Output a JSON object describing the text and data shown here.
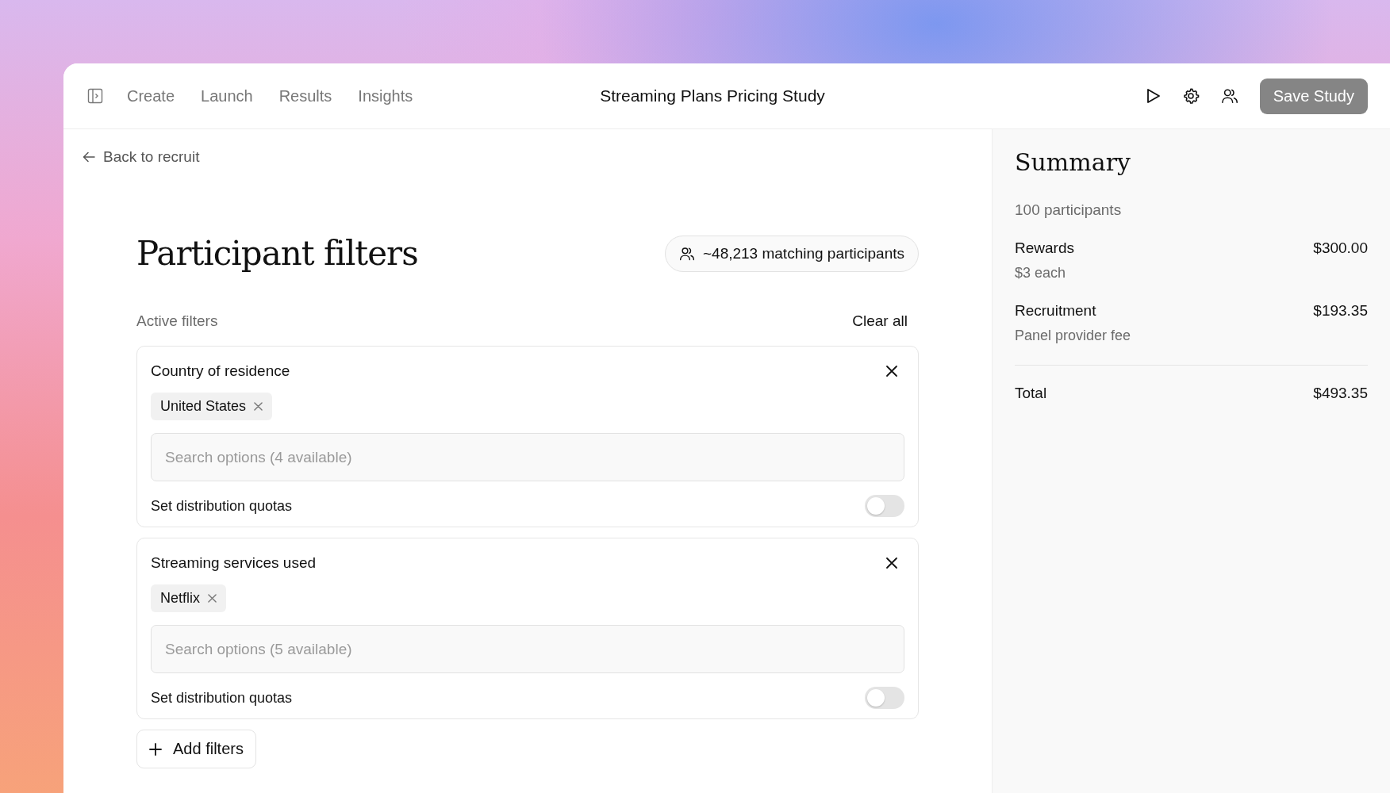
{
  "nav": {
    "tabs": [
      {
        "label": "Create",
        "selected": false
      },
      {
        "label": "Launch",
        "selected": false
      },
      {
        "label": "Results",
        "selected": false
      },
      {
        "label": "Insights",
        "selected": false
      }
    ]
  },
  "title": "Streaming Plans Pricing Study",
  "save_button": {
    "label": "Save Study",
    "disabled": true
  },
  "back_link": "Back to recruit",
  "heading": "Participant filters",
  "match_count": "~48,213 matching participants",
  "active_filters_label": "Active filters",
  "clear_all": "Clear all",
  "filters": [
    {
      "name": "Country of residence",
      "tags": [
        "United States"
      ],
      "search_placeholder": "Search options (4 available)",
      "quota_label": "Set distribution quotas",
      "quotas_on": false
    },
    {
      "name": "Streaming services used",
      "tags": [
        "Netflix"
      ],
      "search_placeholder": "Search options (5 available)",
      "quota_label": "Set distribution quotas",
      "quotas_on": false
    }
  ],
  "add_filters": "Add filters",
  "summary": {
    "title": "Summary",
    "participants": "100 participants",
    "lines": [
      {
        "label": "Rewards",
        "amount": "$300.00",
        "note": "$3 each"
      },
      {
        "label": "Recruitment",
        "amount": "$193.35",
        "note": "Panel provider fee"
      }
    ],
    "total_label": "Total",
    "total": "$493.35"
  }
}
